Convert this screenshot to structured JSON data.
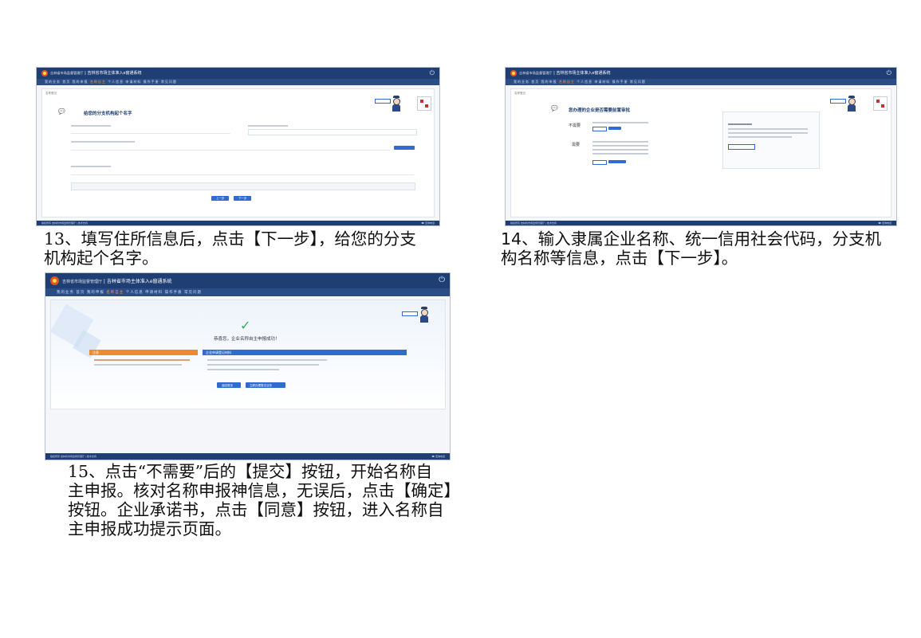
{
  "system": {
    "org_name": "吉林省市场监督管理厅",
    "title": "吉林省市场主体准入e窗通系统"
  },
  "nav": {
    "user": "我的业务",
    "items": [
      "首页",
      "我的申报",
      "名称自主",
      "个人信息",
      "申请材料",
      "操作手册",
      "常见问题"
    ],
    "active": "名称自主"
  },
  "screens": {
    "s13": {
      "breadcrumb": "名称登记",
      "heading": "给您的分支机构起个名字",
      "prev_button": "上一步",
      "next_button": "下一步"
    },
    "s14": {
      "breadcrumb": "名称登记",
      "heading": "您办理的企业是否需要前置审批",
      "option_no": "不需要",
      "option_yes": "需要",
      "submit_button": "提交",
      "confirm_button": "确定"
    },
    "s15": {
      "success_msg": "恭喜您，企业名称自主申报成功！",
      "notice_title": "注意",
      "materials_title": "企业申请登记材料",
      "btn_left": "返回首页",
      "btn_right": "立即办理登记业务"
    }
  },
  "captions": {
    "c13_num": "13",
    "c13_l1": "、填写住所信息后，点击【下一步】，给您的分支",
    "c13_l2": "机构起个名字。",
    "c14_num": "14",
    "c14_l1": "、输入隶属企业名称、统一信用社会代码，分支机",
    "c14_l2": "构名称等信息，点击【下一步】。",
    "c15_num": "15",
    "c15_l1": "、点击“不需要”后的【提交】按钮，开始名称自",
    "c15_l2": "主申报。核对名称申报神信息，无误后，点击【确定】",
    "c15_l3": "按钮。企业承诺书，点击【同意】按钮，进入名称自",
    "c15_l4": "主申报成功提示页面。"
  },
  "colors": {
    "header": "#1f3f74",
    "nav": "#2a4d86",
    "accent": "#2f6bd1",
    "orange": "#f08a2c"
  }
}
